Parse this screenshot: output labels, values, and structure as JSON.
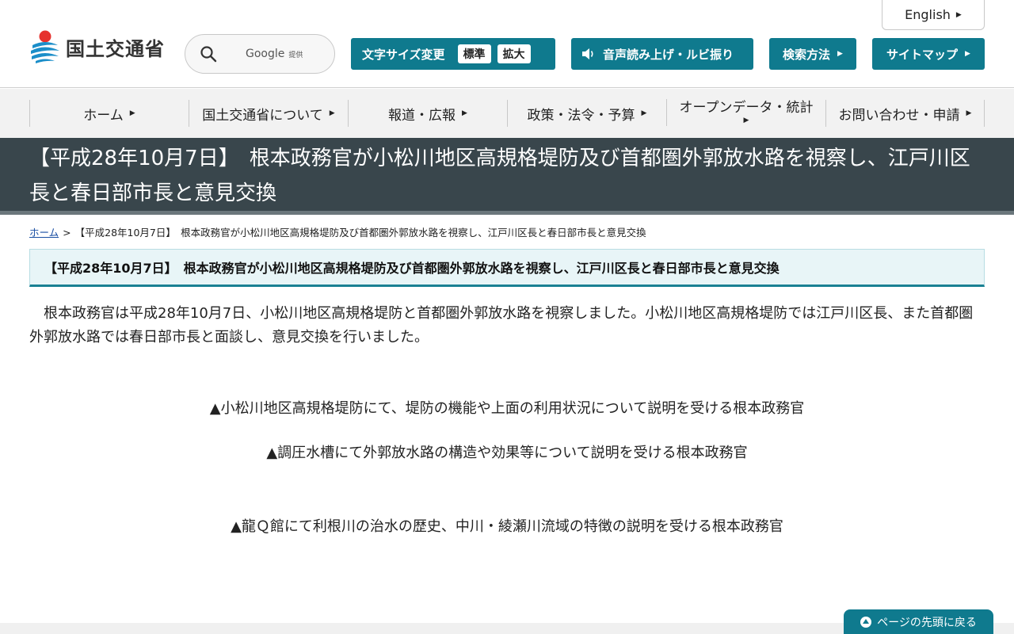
{
  "header": {
    "language_link": "English",
    "logo_text": "国土交通省",
    "search": {
      "provider": "Google",
      "provider_suffix": "提供"
    },
    "font_size": {
      "label": "文字サイズ変更",
      "standard": "標準",
      "large": "拡大"
    },
    "voice_label": "音声読み上げ・ルビ振り",
    "howto_label": "検索方法",
    "sitemap_label": "サイトマップ"
  },
  "nav": {
    "items": [
      {
        "label": "ホーム"
      },
      {
        "label": "国土交通省について"
      },
      {
        "label": "報道・広報"
      },
      {
        "label": "政策・法令・予算"
      },
      {
        "label": "オープンデータ・統計"
      },
      {
        "label": "お問い合わせ・申請"
      }
    ]
  },
  "page": {
    "title": "【平成28年10月7日】　根本政務官が小松川地区高規格堤防及び首都圏外郭放水路を視察し、江戸川区長と春日部市長と意見交換",
    "breadcrumb": {
      "home": "ホーム",
      "separator": ">",
      "current": "【平成28年10月7日】　根本政務官が小松川地区高規格堤防及び首都圏外郭放水路を視察し、江戸川区長と春日部市長と意見交換"
    },
    "subheading": "【平成28年10月7日】　根本政務官が小松川地区高規格堤防及び首都圏外郭放水路を視察し、江戸川区長と春日部市長と意見交換",
    "intro": "根本政務官は平成28年10月7日、小松川地区高規格堤防と首都圏外郭放水路を視察しました。小松川地区高規格堤防では江戸川区長、また首都圏外郭放水路では春日部市長と面談し、意見交換を行いました。",
    "captions": [
      "▲小松川地区高規格堤防にて、堤防の機能や上面の利用状況について説明を受ける根本政務官",
      "▲調圧水槽にて外郭放水路の構造や効果等について説明を受ける根本政務官",
      "▲龍Ｑ館にて利根川の治水の歴史、中川・綾瀬川流域の特徴の説明を受ける根本政務官"
    ]
  },
  "page_top_label": "ページの先頭に戻る",
  "colors": {
    "accent_teal": "#0f7a8e",
    "title_bar_bg": "#39464c",
    "nav_bg": "#f2f2f2",
    "subheading_bg": "#e8f5f7"
  }
}
